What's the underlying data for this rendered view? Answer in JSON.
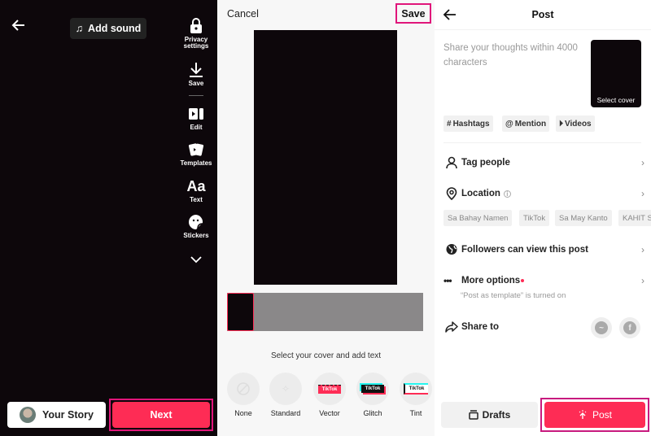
{
  "left_panel": {
    "add_sound_label": "Add sound",
    "tools": [
      {
        "label_line1": "Privacy",
        "label_line2": "settings",
        "icon": "lock-icon"
      },
      {
        "label_line1": "Save",
        "label_line2": "",
        "icon": "download-icon"
      },
      {
        "label_line1": "Edit",
        "label_line2": "",
        "icon": "edit-clip-icon"
      },
      {
        "label_line1": "Templates",
        "label_line2": "",
        "icon": "templates-icon"
      },
      {
        "label_line1": "Text",
        "label_line2": "",
        "icon": "text-icon",
        "glyph": "Aa"
      },
      {
        "label_line1": "Stickers",
        "label_line2": "",
        "icon": "sticker-icon"
      }
    ],
    "your_story_label": "Your Story",
    "next_label": "Next"
  },
  "middle_panel": {
    "cancel_label": "Cancel",
    "save_label": "Save",
    "cover_hint": "Select your cover and add text",
    "styles": [
      {
        "label": "None"
      },
      {
        "label": "Standard"
      },
      {
        "label": "Vector",
        "badge": "TikTok"
      },
      {
        "label": "Glitch",
        "badge": "TikTok"
      },
      {
        "label": "Tint",
        "badge": "TikTok"
      }
    ]
  },
  "right_panel": {
    "title": "Post",
    "caption_placeholder": "Share your thoughts within 4000 characters",
    "select_cover_label": "Select cover",
    "chips": [
      "Hashtags",
      "Mention",
      "Videos"
    ],
    "tag_people_label": "Tag people",
    "location_label": "Location",
    "location_suggestions": [
      "Sa Bahay Namen",
      "TikTok",
      "Sa May Kanto",
      "KAHIT S"
    ],
    "privacy_label": "Followers can view this post",
    "more_options_label": "More options",
    "more_options_sub": "“Post as template” is turned on",
    "share_to_label": "Share to",
    "drafts_label": "Drafts",
    "post_label": "Post"
  },
  "colors": {
    "accent": "#fe2c55",
    "highlight_border": "#e0157a"
  }
}
